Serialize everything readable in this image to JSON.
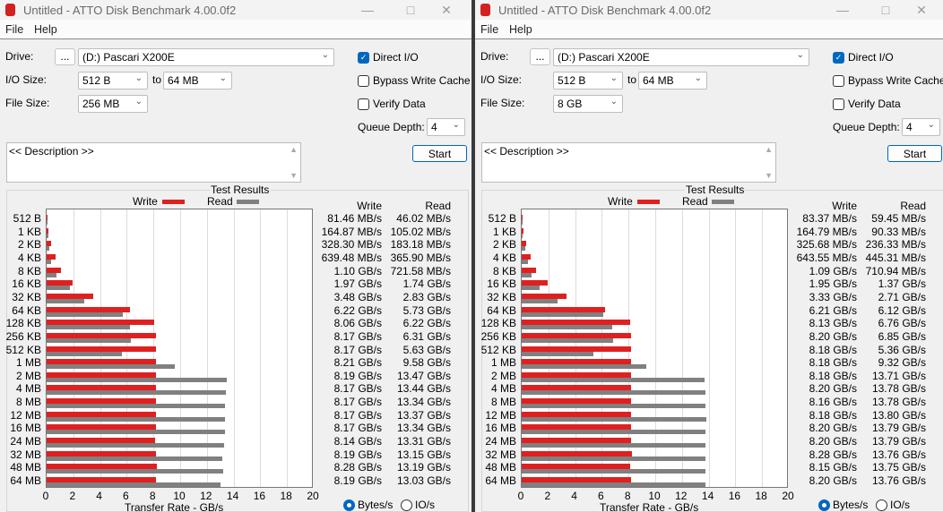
{
  "colors": {
    "write": "#e02020",
    "read": "#808080",
    "accent": "#0067c0"
  },
  "windows": [
    {
      "title": "Untitled - ATTO Disk Benchmark 4.00.0f2",
      "menu": [
        "File",
        "Help"
      ],
      "drive_label": "Drive:",
      "browse_label": "...",
      "drive_value": "(D:) Pascari X200E",
      "io_size_label": "I/O Size:",
      "io_from": "512 B",
      "to_label": "to",
      "io_to": "64 MB",
      "file_size_label": "File Size:",
      "file_size": "256 MB",
      "direct_io": {
        "label": "Direct I/O",
        "checked": true
      },
      "bypass_write_cache": {
        "label": "Bypass Write Cache",
        "checked": false
      },
      "verify_data": {
        "label": "Verify Data",
        "checked": false
      },
      "queue_depth_label": "Queue Depth:",
      "queue_depth": "4",
      "start_label": "Start",
      "description": "<< Description >>",
      "results_title": "Test Results",
      "legend_write": "Write",
      "legend_read": "Read",
      "col_write": "Write",
      "col_read": "Read",
      "rows": [
        "512 B",
        "1 KB",
        "2 KB",
        "4 KB",
        "8 KB",
        "16 KB",
        "32 KB",
        "64 KB",
        "128 KB",
        "256 KB",
        "512 KB",
        "1 MB",
        "2 MB",
        "4 MB",
        "8 MB",
        "12 MB",
        "16 MB",
        "24 MB",
        "32 MB",
        "48 MB",
        "64 MB"
      ],
      "write_text": [
        "81.46 MB/s",
        "164.87 MB/s",
        "328.30 MB/s",
        "639.48 MB/s",
        "1.10 GB/s",
        "1.97 GB/s",
        "3.48 GB/s",
        "6.22 GB/s",
        "8.06 GB/s",
        "8.17 GB/s",
        "8.17 GB/s",
        "8.21 GB/s",
        "8.19 GB/s",
        "8.17 GB/s",
        "8.17 GB/s",
        "8.17 GB/s",
        "8.17 GB/s",
        "8.14 GB/s",
        "8.19 GB/s",
        "8.28 GB/s",
        "8.19 GB/s"
      ],
      "read_text": [
        "46.02 MB/s",
        "105.02 MB/s",
        "183.18 MB/s",
        "365.90 MB/s",
        "721.58 MB/s",
        "1.74 GB/s",
        "2.83 GB/s",
        "5.73 GB/s",
        "6.22 GB/s",
        "6.31 GB/s",
        "5.63 GB/s",
        "9.58 GB/s",
        "13.47 GB/s",
        "13.44 GB/s",
        "13.34 GB/s",
        "13.37 GB/s",
        "13.34 GB/s",
        "13.31 GB/s",
        "13.15 GB/s",
        "13.19 GB/s",
        "13.03 GB/s"
      ],
      "xlabel": "Transfer Rate - GB/s",
      "xticks": [
        "0",
        "2",
        "4",
        "6",
        "8",
        "10",
        "12",
        "14",
        "16",
        "18",
        "20"
      ],
      "unit_bytes": {
        "label": "Bytes/s",
        "selected": true
      },
      "unit_io": {
        "label": "IO/s",
        "selected": false
      }
    },
    {
      "title": "Untitled - ATTO Disk Benchmark 4.00.0f2",
      "menu": [
        "File",
        "Help"
      ],
      "drive_label": "Drive:",
      "browse_label": "...",
      "drive_value": "(D:) Pascari X200E",
      "io_size_label": "I/O Size:",
      "io_from": "512 B",
      "to_label": "to",
      "io_to": "64 MB",
      "file_size_label": "File Size:",
      "file_size": "8 GB",
      "direct_io": {
        "label": "Direct I/O",
        "checked": true
      },
      "bypass_write_cache": {
        "label": "Bypass Write Cache",
        "checked": false
      },
      "verify_data": {
        "label": "Verify Data",
        "checked": false
      },
      "queue_depth_label": "Queue Depth:",
      "queue_depth": "4",
      "start_label": "Start",
      "description": "<< Description >>",
      "results_title": "Test Results",
      "legend_write": "Write",
      "legend_read": "Read",
      "col_write": "Write",
      "col_read": "Read",
      "rows": [
        "512 B",
        "1 KB",
        "2 KB",
        "4 KB",
        "8 KB",
        "16 KB",
        "32 KB",
        "64 KB",
        "128 KB",
        "256 KB",
        "512 KB",
        "1 MB",
        "2 MB",
        "4 MB",
        "8 MB",
        "12 MB",
        "16 MB",
        "24 MB",
        "32 MB",
        "48 MB",
        "64 MB"
      ],
      "write_text": [
        "83.37 MB/s",
        "164.79 MB/s",
        "325.68 MB/s",
        "643.55 MB/s",
        "1.09 GB/s",
        "1.95 GB/s",
        "3.33 GB/s",
        "6.21 GB/s",
        "8.13 GB/s",
        "8.20 GB/s",
        "8.18 GB/s",
        "8.18 GB/s",
        "8.18 GB/s",
        "8.20 GB/s",
        "8.16 GB/s",
        "8.18 GB/s",
        "8.20 GB/s",
        "8.20 GB/s",
        "8.28 GB/s",
        "8.15 GB/s",
        "8.20 GB/s"
      ],
      "read_text": [
        "59.45 MB/s",
        "90.33 MB/s",
        "236.33 MB/s",
        "445.31 MB/s",
        "710.94 MB/s",
        "1.37 GB/s",
        "2.71 GB/s",
        "6.12 GB/s",
        "6.76 GB/s",
        "6.85 GB/s",
        "5.36 GB/s",
        "9.32 GB/s",
        "13.71 GB/s",
        "13.78 GB/s",
        "13.78 GB/s",
        "13.80 GB/s",
        "13.79 GB/s",
        "13.79 GB/s",
        "13.76 GB/s",
        "13.75 GB/s",
        "13.76 GB/s"
      ],
      "xlabel": "Transfer Rate - GB/s",
      "xticks": [
        "0",
        "2",
        "4",
        "6",
        "8",
        "10",
        "12",
        "14",
        "16",
        "18",
        "20"
      ],
      "unit_bytes": {
        "label": "Bytes/s",
        "selected": true
      },
      "unit_io": {
        "label": "IO/s",
        "selected": false
      }
    }
  ],
  "chart_data": [
    {
      "type": "bar",
      "orientation": "horizontal",
      "title": "Test Results",
      "xlabel": "Transfer Rate - GB/s",
      "xlim": [
        0,
        20
      ],
      "grid": true,
      "legend": "top",
      "categories": [
        "512 B",
        "1 KB",
        "2 KB",
        "4 KB",
        "8 KB",
        "16 KB",
        "32 KB",
        "64 KB",
        "128 KB",
        "256 KB",
        "512 KB",
        "1 MB",
        "2 MB",
        "4 MB",
        "8 MB",
        "12 MB",
        "16 MB",
        "24 MB",
        "32 MB",
        "48 MB",
        "64 MB"
      ],
      "series": [
        {
          "name": "Write",
          "values": [
            0.08146,
            0.16487,
            0.3283,
            0.63948,
            1.1,
            1.97,
            3.48,
            6.22,
            8.06,
            8.17,
            8.17,
            8.21,
            8.19,
            8.17,
            8.17,
            8.17,
            8.17,
            8.14,
            8.19,
            8.28,
            8.19
          ]
        },
        {
          "name": "Read",
          "values": [
            0.04602,
            0.10502,
            0.18318,
            0.3659,
            0.72158,
            1.74,
            2.83,
            5.73,
            6.22,
            6.31,
            5.63,
            9.58,
            13.47,
            13.44,
            13.34,
            13.37,
            13.34,
            13.31,
            13.15,
            13.19,
            13.03
          ]
        }
      ]
    },
    {
      "type": "bar",
      "orientation": "horizontal",
      "title": "Test Results",
      "xlabel": "Transfer Rate - GB/s",
      "xlim": [
        0,
        20
      ],
      "grid": true,
      "legend": "top",
      "categories": [
        "512 B",
        "1 KB",
        "2 KB",
        "4 KB",
        "8 KB",
        "16 KB",
        "32 KB",
        "64 KB",
        "128 KB",
        "256 KB",
        "512 KB",
        "1 MB",
        "2 MB",
        "4 MB",
        "8 MB",
        "12 MB",
        "16 MB",
        "24 MB",
        "32 MB",
        "48 MB",
        "64 MB"
      ],
      "series": [
        {
          "name": "Write",
          "values": [
            0.08337,
            0.16479,
            0.32568,
            0.64355,
            1.09,
            1.95,
            3.33,
            6.21,
            8.13,
            8.2,
            8.18,
            8.18,
            8.18,
            8.2,
            8.16,
            8.18,
            8.2,
            8.2,
            8.28,
            8.15,
            8.2
          ]
        },
        {
          "name": "Read",
          "values": [
            0.05945,
            0.09033,
            0.23633,
            0.44531,
            0.71094,
            1.37,
            2.71,
            6.12,
            6.76,
            6.85,
            5.36,
            9.32,
            13.71,
            13.78,
            13.78,
            13.8,
            13.79,
            13.79,
            13.76,
            13.75,
            13.76
          ]
        }
      ]
    }
  ]
}
